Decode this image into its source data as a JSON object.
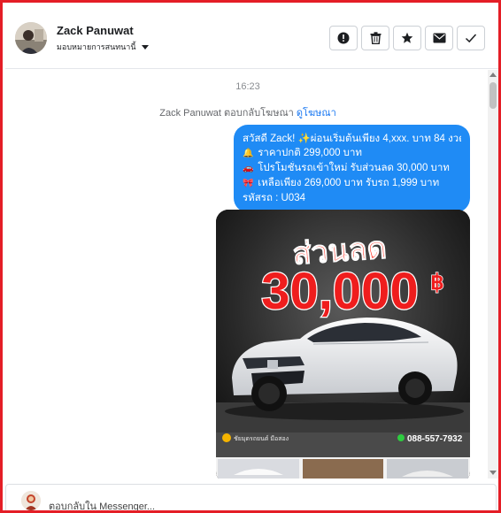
{
  "header": {
    "name": "Zack Panuwat",
    "assign_label": "มอบหมายการสนทนานี้",
    "actions": [
      "mark-spam",
      "delete",
      "star",
      "mark-unread",
      "mark-done"
    ]
  },
  "thread": {
    "timestamp": "16:23",
    "reply_context": {
      "text": "Zack Panuwat ตอบกลับโฆษณา",
      "link": "ดูโฆษณา"
    },
    "message": {
      "lines": [
        {
          "emoji": "",
          "text": "สวัสดี Zack! ✨ผ่อนเริ่มต้นเพียง 4,xxx. บาท 84 งวด"
        },
        {
          "emoji": "🔔",
          "text": "ราคาปกติ 299,000 บาท"
        },
        {
          "emoji": "🚗",
          "text": "โปรโมชั่นรถเข้าใหม่ รับส่วนลด 30,000 บาท"
        },
        {
          "emoji": "🎀",
          "text": "เหลือเพียง 269,000 บาท รับรถ 1,999 บาท"
        },
        {
          "emoji": "",
          "text": "รหัสรถ : U034"
        }
      ]
    },
    "ad_card": {
      "headline": "ส่วนลด",
      "amount": "30,000",
      "currency": "฿",
      "phone": "088-557-7932",
      "footer_logo_text": "ชัยมุดรถยนต์ มือสอง"
    }
  },
  "composer": {
    "placeholder": "ตอบกลับใน Messenger..."
  },
  "colors": {
    "frame": "#e41e26",
    "bubble": "#1f8bf5",
    "link": "#1877f2",
    "ad_red": "#e8241f"
  }
}
